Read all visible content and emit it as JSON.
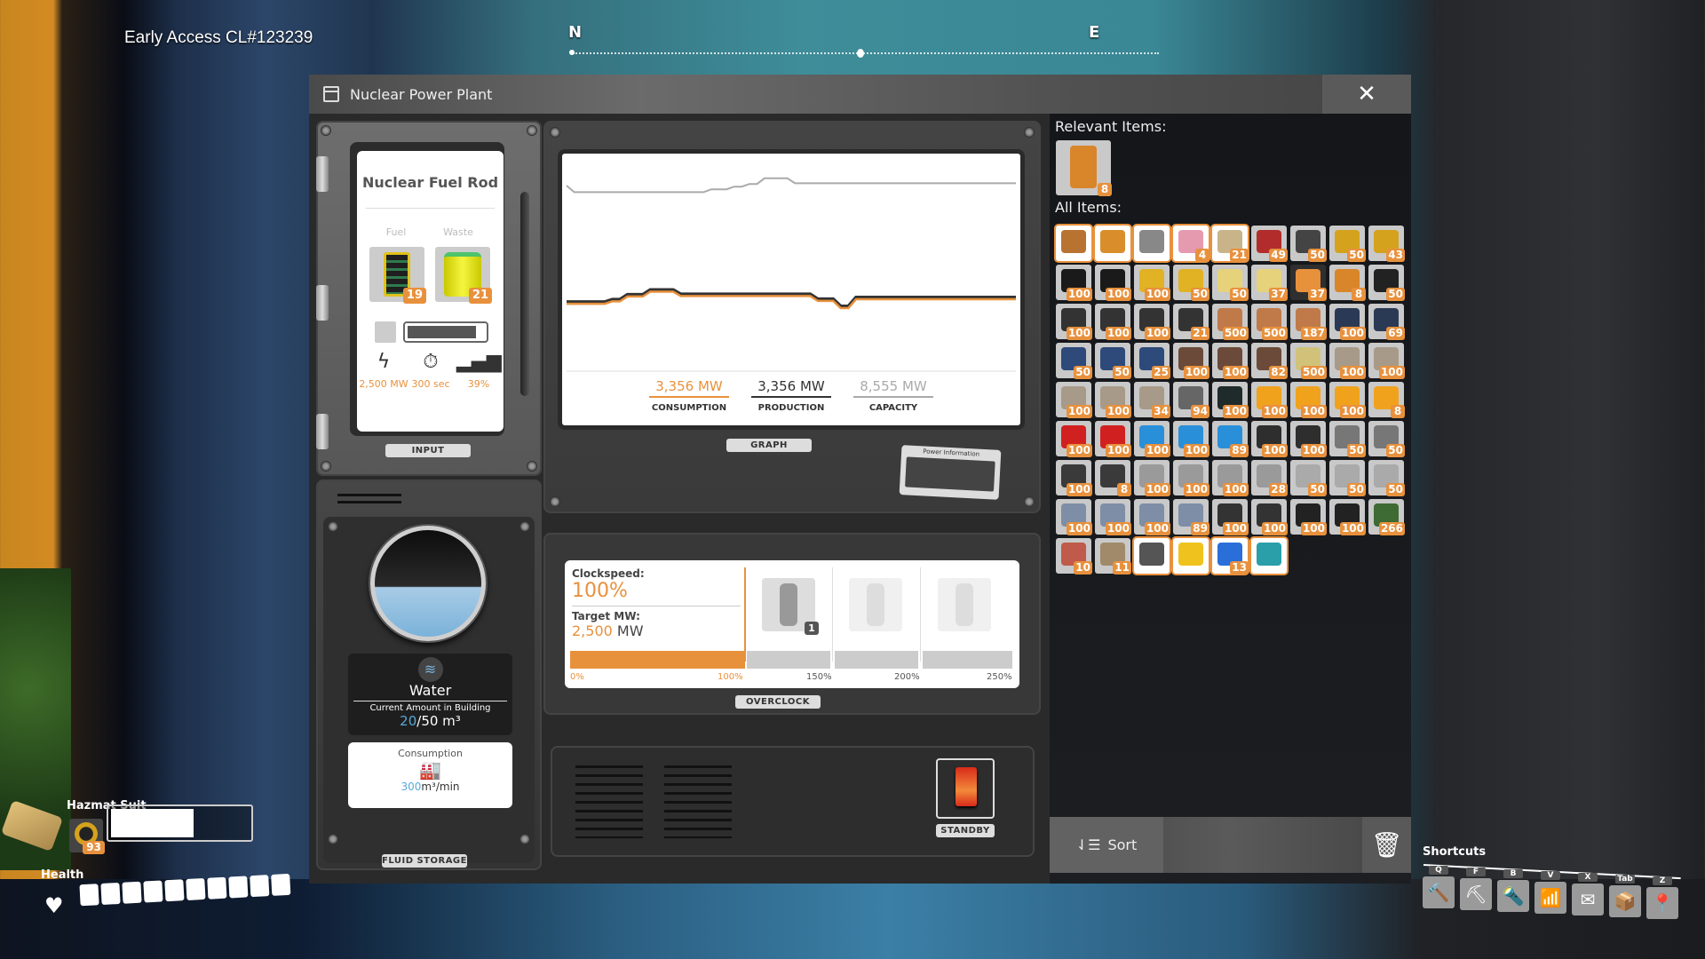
{
  "hud": {
    "build": "Early Access CL#123239",
    "compass": {
      "north": "N",
      "east": "E"
    }
  },
  "window": {
    "title": "Nuclear Power Plant",
    "close": "✕"
  },
  "input": {
    "tag": "INPUT",
    "recipe_title": "Nuclear Fuel Rod",
    "fuel_label": "Fuel",
    "fuel_count": "19",
    "waste_label": "Waste",
    "waste_count": "21",
    "burn_progress": 0.9,
    "power": "2,500 MW",
    "duration": "300 sec",
    "productivity": "39%"
  },
  "graph": {
    "tag": "GRAPH",
    "power_info_card": "Power Information",
    "consumption_value": "3,356 MW",
    "consumption_label": "CONSUMPTION",
    "production_value": "3,356 MW",
    "production_label": "PRODUCTION",
    "capacity_value": "8,555 MW",
    "capacity_label": "CAPACITY",
    "colors": {
      "consumption": "#e8913d",
      "production": "#333333",
      "capacity": "#aaaaaa"
    }
  },
  "chart_data": {
    "type": "line",
    "title": "",
    "xlabel": "",
    "ylabel": "",
    "ylim": [
      0,
      9500
    ],
    "x": [
      0,
      1,
      2,
      3,
      4,
      5,
      6,
      7,
      8,
      9,
      10,
      11,
      12,
      13,
      14,
      15,
      16,
      17,
      18,
      19,
      20,
      21,
      22,
      23,
      24,
      25,
      26,
      27,
      28,
      29,
      30,
      31,
      32,
      33,
      34,
      35,
      36,
      37,
      38,
      39,
      40,
      41,
      42,
      43,
      44,
      45,
      46,
      47,
      48,
      49,
      50,
      51,
      52,
      53,
      54,
      55,
      56,
      57,
      58,
      59
    ],
    "series": [
      {
        "name": "Capacity",
        "values": [
          8450,
          8150,
          8150,
          8150,
          8150,
          8150,
          8150,
          8150,
          8150,
          8150,
          8150,
          8150,
          8150,
          8150,
          8150,
          8150,
          8150,
          8150,
          8150,
          8280,
          8280,
          8280,
          8400,
          8400,
          8520,
          8520,
          8780,
          8780,
          8780,
          8780,
          8555,
          8555,
          8555,
          8555,
          8555,
          8555,
          8555,
          8555,
          8555,
          8555,
          8555,
          8555,
          8555,
          8555,
          8555,
          8555,
          8555,
          8555,
          8555,
          8555,
          8555,
          8555,
          8555,
          8555,
          8555,
          8555,
          8555,
          8555,
          8555,
          8555
        ]
      },
      {
        "name": "Production",
        "values": [
          3150,
          3150,
          3150,
          3150,
          3150,
          3150,
          3260,
          3260,
          3480,
          3480,
          3480,
          3700,
          3700,
          3700,
          3700,
          3500,
          3500,
          3500,
          3500,
          3500,
          3500,
          3500,
          3500,
          3500,
          3500,
          3500,
          3500,
          3500,
          3500,
          3500,
          3500,
          3500,
          3500,
          3280,
          3280,
          3280,
          2950,
          2950,
          3356,
          3356,
          3356,
          3356,
          3356,
          3356,
          3356,
          3356,
          3356,
          3356,
          3356,
          3356,
          3356,
          3356,
          3356,
          3356,
          3356,
          3356,
          3356,
          3356,
          3356,
          3356
        ]
      },
      {
        "name": "Consumption",
        "values": [
          3150,
          3150,
          3150,
          3150,
          3150,
          3150,
          3260,
          3260,
          3480,
          3480,
          3480,
          3700,
          3700,
          3700,
          3700,
          3500,
          3500,
          3500,
          3500,
          3500,
          3500,
          3500,
          3500,
          3500,
          3500,
          3500,
          3500,
          3500,
          3500,
          3500,
          3500,
          3500,
          3500,
          3280,
          3280,
          3280,
          2950,
          2950,
          3356,
          3356,
          3356,
          3356,
          3356,
          3356,
          3356,
          3356,
          3356,
          3356,
          3356,
          3356,
          3356,
          3356,
          3356,
          3356,
          3356,
          3356,
          3356,
          3356,
          3356,
          3356
        ]
      }
    ]
  },
  "overclock": {
    "tag": "OVERCLOCK",
    "clockspeed_label": "Clockspeed:",
    "clockspeed_value": "100%",
    "target_label": "Target MW:",
    "target_value": "2,500",
    "target_unit": "MW",
    "shard_count": "1",
    "clock_fraction": 0.4,
    "ticks": [
      "0%",
      "100%",
      "150%",
      "200%",
      "250%"
    ]
  },
  "fluid": {
    "tag": "FLUID STORAGE",
    "name": "Water",
    "amount_label": "Current Amount in Building",
    "amount_current": "20",
    "amount_max": "/50 m³",
    "fill_fraction": 0.4,
    "consumption_label": "Consumption",
    "consumption_value": "300",
    "consumption_unit": "m³/min"
  },
  "standby": {
    "tag": "STANDBY",
    "state": "on"
  },
  "inventory": {
    "relevant_label": "Relevant Items:",
    "relevant": [
      {
        "name": "uranium-fuel-cell",
        "count": "8",
        "color": "#d9852a"
      }
    ],
    "all_label": "All Items:",
    "items": [
      {
        "name": "gas-mask",
        "count": "",
        "color": "#b87333",
        "white": true
      },
      {
        "name": "jetpack",
        "count": "",
        "color": "#d98e2b",
        "white": true
      },
      {
        "name": "hover-pack",
        "count": "",
        "color": "#888",
        "white": true
      },
      {
        "name": "parachute",
        "count": "4",
        "color": "#e69ab0",
        "white": true
      },
      {
        "name": "medicinal-inhaler",
        "count": "21",
        "color": "#c9b48a",
        "white": true
      },
      {
        "name": "nobelisk",
        "count": "49",
        "color": "#b22c2c"
      },
      {
        "name": "filter",
        "count": "50",
        "color": "#444"
      },
      {
        "name": "iodine-filter",
        "count": "50",
        "color": "#d4a21c"
      },
      {
        "name": "iodine-filter",
        "count": "43",
        "color": "#d4a21c"
      },
      {
        "name": "black-powder",
        "count": "100",
        "color": "#1a1a1a"
      },
      {
        "name": "black-powder",
        "count": "100",
        "color": "#1a1a1a"
      },
      {
        "name": "rifle-cartridge",
        "count": "100",
        "color": "#e0b224"
      },
      {
        "name": "rifle-cartridge",
        "count": "50",
        "color": "#e0b224"
      },
      {
        "name": "battery",
        "count": "50",
        "color": "#e6d27a"
      },
      {
        "name": "battery",
        "count": "37",
        "color": "#e6d27a"
      },
      {
        "name": "ficsit-coupon",
        "count": "37",
        "color": "#e8913d",
        "dark": true
      },
      {
        "name": "uranium-fuel-cell",
        "count": "8",
        "color": "#d9852a"
      },
      {
        "name": "turbo-motor",
        "count": "50",
        "color": "#222"
      },
      {
        "name": "rubber-tube",
        "count": "100",
        "color": "#333"
      },
      {
        "name": "rubber-tube",
        "count": "100",
        "color": "#333"
      },
      {
        "name": "rubber-tube",
        "count": "100",
        "color": "#333"
      },
      {
        "name": "rubber-tube",
        "count": "21",
        "color": "#333"
      },
      {
        "name": "copper-wire-spool",
        "count": "500",
        "color": "#c07a4a"
      },
      {
        "name": "copper-wire-spool",
        "count": "500",
        "color": "#c07a4a"
      },
      {
        "name": "copper-wire-spool",
        "count": "187",
        "color": "#c07a4a"
      },
      {
        "name": "stator",
        "count": "100",
        "color": "#2a3a55"
      },
      {
        "name": "stator",
        "count": "69",
        "color": "#2a3a55"
      },
      {
        "name": "motor",
        "count": "50",
        "color": "#2d4a7a"
      },
      {
        "name": "motor",
        "count": "50",
        "color": "#2d4a7a"
      },
      {
        "name": "motor",
        "count": "25",
        "color": "#2d4a7a"
      },
      {
        "name": "rotor",
        "count": "100",
        "color": "#6b4a3a"
      },
      {
        "name": "rotor",
        "count": "100",
        "color": "#6b4a3a"
      },
      {
        "name": "rotor",
        "count": "82",
        "color": "#6b4a3a"
      },
      {
        "name": "quickwire",
        "count": "500",
        "color": "#d1c27a"
      },
      {
        "name": "concrete",
        "count": "100",
        "color": "#a89a88"
      },
      {
        "name": "concrete",
        "count": "100",
        "color": "#a89a88"
      },
      {
        "name": "concrete",
        "count": "100",
        "color": "#a89a88"
      },
      {
        "name": "concrete",
        "count": "100",
        "color": "#a89a88"
      },
      {
        "name": "concrete",
        "count": "34",
        "color": "#a89a88"
      },
      {
        "name": "computer-fan",
        "count": "94",
        "color": "#666"
      },
      {
        "name": "circuit-board",
        "count": "100",
        "color": "#1f2a2a"
      },
      {
        "name": "modular-frame",
        "count": "100",
        "color": "#f0a21d"
      },
      {
        "name": "modular-frame",
        "count": "100",
        "color": "#f0a21d"
      },
      {
        "name": "modular-frame",
        "count": "100",
        "color": "#f0a21d"
      },
      {
        "name": "modular-frame",
        "count": "8",
        "color": "#f0a21d"
      },
      {
        "name": "heavy-frame",
        "count": "100",
        "color": "#d12020"
      },
      {
        "name": "heavy-frame",
        "count": "100",
        "color": "#d12020"
      },
      {
        "name": "plastic",
        "count": "100",
        "color": "#2a8fd9"
      },
      {
        "name": "plastic",
        "count": "100",
        "color": "#2a8fd9"
      },
      {
        "name": "plastic",
        "count": "89",
        "color": "#2a8fd9"
      },
      {
        "name": "rubber",
        "count": "100",
        "color": "#2e2e2e"
      },
      {
        "name": "rubber",
        "count": "100",
        "color": "#2e2e2e"
      },
      {
        "name": "steel-beam",
        "count": "50",
        "color": "#777"
      },
      {
        "name": "steel-beam",
        "count": "50",
        "color": "#777"
      },
      {
        "name": "steel-pipe",
        "count": "100",
        "color": "#3a3a3a"
      },
      {
        "name": "steel-pipe",
        "count": "8",
        "color": "#3a3a3a"
      },
      {
        "name": "iron-plate",
        "count": "100",
        "color": "#9a9a9a"
      },
      {
        "name": "iron-plate",
        "count": "100",
        "color": "#9a9a9a"
      },
      {
        "name": "iron-plate",
        "count": "100",
        "color": "#9a9a9a"
      },
      {
        "name": "iron-plate",
        "count": "28",
        "color": "#9a9a9a"
      },
      {
        "name": "iron-rod-frame",
        "count": "50",
        "color": "#aaa"
      },
      {
        "name": "iron-rod-frame",
        "count": "50",
        "color": "#aaa"
      },
      {
        "name": "iron-rod-frame",
        "count": "50",
        "color": "#aaa"
      },
      {
        "name": "reinforced-plate",
        "count": "100",
        "color": "#7d8ea6"
      },
      {
        "name": "reinforced-plate",
        "count": "100",
        "color": "#7d8ea6"
      },
      {
        "name": "reinforced-plate",
        "count": "100",
        "color": "#7d8ea6"
      },
      {
        "name": "reinforced-plate",
        "count": "89",
        "color": "#7d8ea6"
      },
      {
        "name": "encased-beam",
        "count": "100",
        "color": "#333"
      },
      {
        "name": "encased-beam",
        "count": "100",
        "color": "#333"
      },
      {
        "name": "heat-sink",
        "count": "100",
        "color": "#222"
      },
      {
        "name": "heat-sink",
        "count": "100",
        "color": "#222"
      },
      {
        "name": "leaves",
        "count": "266",
        "color": "#3e6a33"
      },
      {
        "name": "flower-petals",
        "count": "10",
        "color": "#c05a4a"
      },
      {
        "name": "wood",
        "count": "11",
        "color": "#a08a6a"
      },
      {
        "name": "chainsaw",
        "count": "",
        "color": "#555",
        "white": true
      },
      {
        "name": "portable-miner",
        "count": "",
        "color": "#f0c21d",
        "white": true
      },
      {
        "name": "blade-runners",
        "count": "13",
        "color": "#2a6fd9",
        "white": true
      },
      {
        "name": "xeno-zapper",
        "count": "",
        "color": "#2a9fa9",
        "white": true
      }
    ],
    "sort_label": "Sort",
    "trash_label": "🗑"
  },
  "equipment": {
    "suit_label": "Hazmat Suit",
    "filter_count": "93",
    "filter_fraction": 0.6,
    "health_label": "Health",
    "health_segments": 10
  },
  "shortcuts": {
    "label": "Shortcuts",
    "items": [
      {
        "key": "Q",
        "icon": "🔨",
        "name": "build"
      },
      {
        "key": "F",
        "icon": "⛏",
        "name": "dismantle"
      },
      {
        "key": "B",
        "icon": "🔦",
        "name": "flashlight"
      },
      {
        "key": "V",
        "icon": "📶",
        "name": "scanner"
      },
      {
        "key": "X",
        "icon": "✉",
        "name": "codex"
      },
      {
        "key": "Tab",
        "icon": "📦",
        "name": "inventory"
      },
      {
        "key": "Z",
        "icon": "📍",
        "name": "map"
      }
    ]
  }
}
